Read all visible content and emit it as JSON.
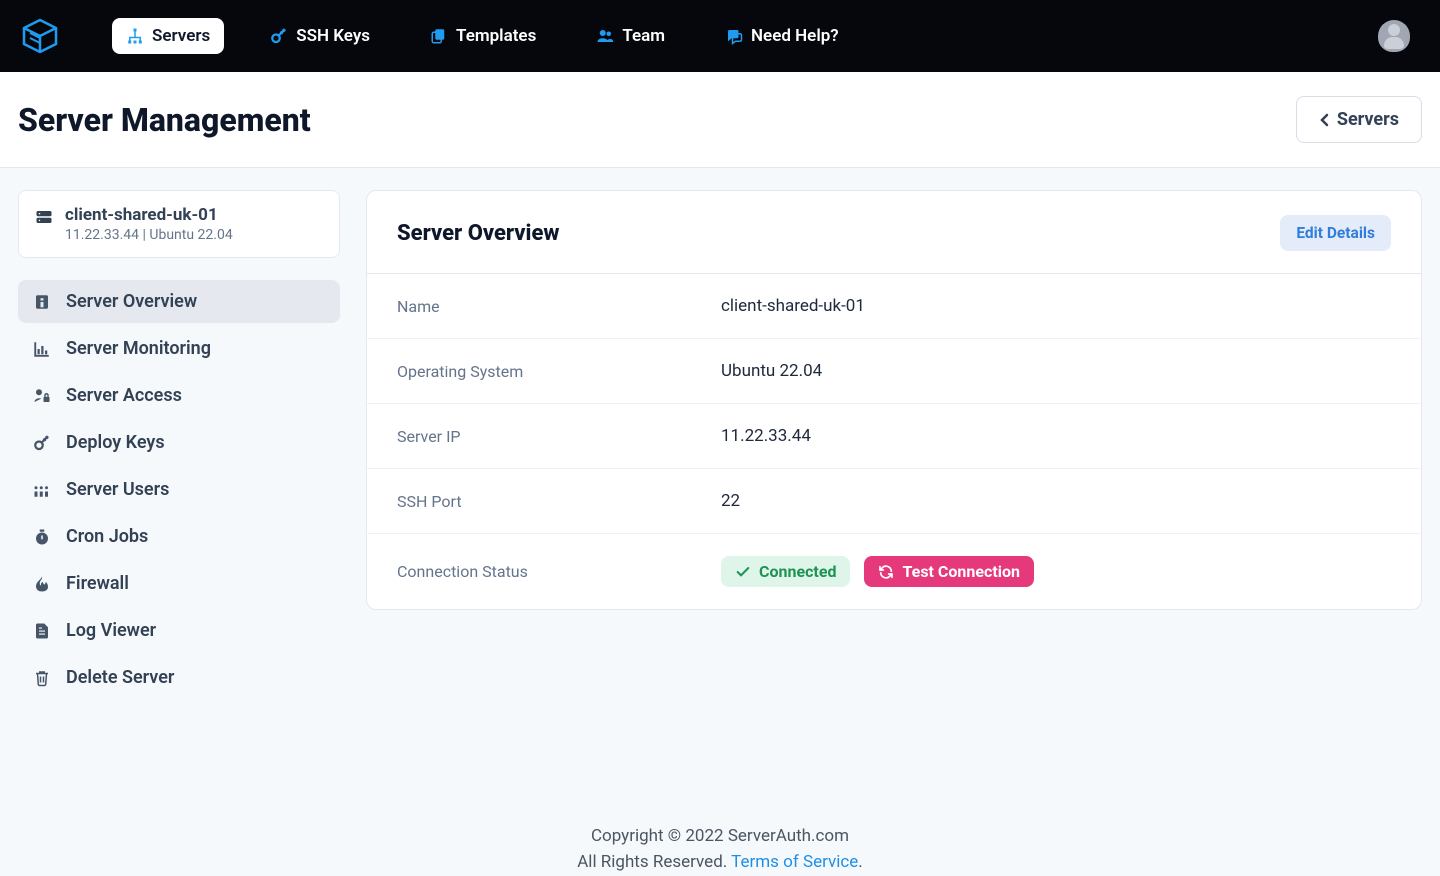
{
  "topnav": {
    "servers": "Servers",
    "ssh_keys": "SSH Keys",
    "templates": "Templates",
    "team": "Team",
    "help": "Need Help?"
  },
  "page": {
    "title": "Server Management",
    "back_label": "Servers"
  },
  "server": {
    "name": "client-shared-uk-01",
    "meta": "11.22.33.44 | Ubuntu 22.04"
  },
  "sidenav": {
    "overview": "Server Overview",
    "monitoring": "Server Monitoring",
    "access": "Server Access",
    "deploy_keys": "Deploy Keys",
    "users": "Server Users",
    "cron": "Cron Jobs",
    "firewall": "Firewall",
    "logs": "Log Viewer",
    "delete": "Delete Server"
  },
  "panel": {
    "title": "Server Overview",
    "edit": "Edit Details",
    "labels": {
      "name": "Name",
      "os": "Operating System",
      "ip": "Server IP",
      "ssh_port": "SSH Port",
      "conn_status": "Connection Status"
    },
    "values": {
      "name": "client-shared-uk-01",
      "os": "Ubuntu 22.04",
      "ip": "11.22.33.44",
      "ssh_port": "22",
      "connected": "Connected",
      "test": "Test Connection"
    }
  },
  "footer": {
    "line1": "Copyright © 2022 ServerAuth.com",
    "line2a": "All Rights Reserved. ",
    "tos": "Terms of Service",
    "dot": "."
  }
}
